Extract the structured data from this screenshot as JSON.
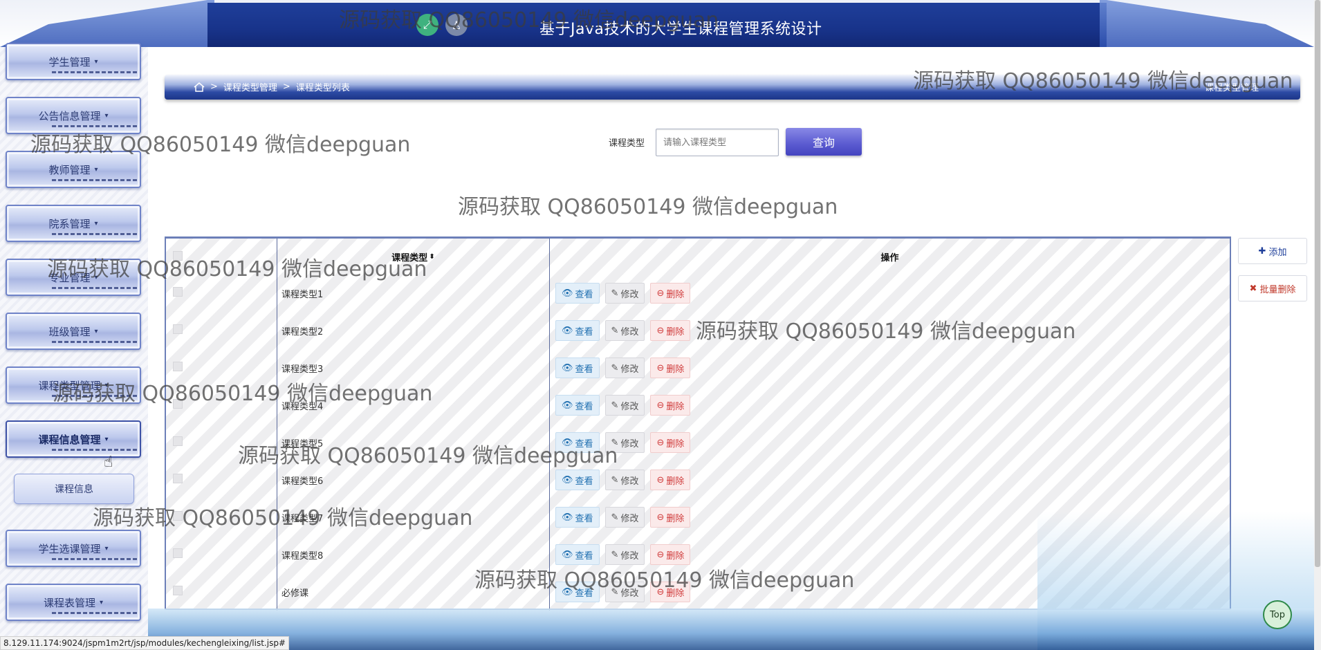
{
  "header": {
    "title": "基于Java技术的大学生课程管理系统设计",
    "icons": [
      "expand-icon",
      "user-icon"
    ]
  },
  "sidebar": {
    "items": [
      {
        "label": "学生管理"
      },
      {
        "label": "公告信息管理"
      },
      {
        "label": "教师管理"
      },
      {
        "label": "院系管理"
      },
      {
        "label": "专业管理"
      },
      {
        "label": "班级管理"
      },
      {
        "label": "课程类型管理"
      },
      {
        "label": "课程信息管理",
        "active": true
      },
      {
        "label": "学生选课管理"
      },
      {
        "label": "课程表管理"
      }
    ],
    "sub_items": [
      {
        "label": "课程信息"
      }
    ]
  },
  "breadcrumb": {
    "separator": ">",
    "items": [
      "课程类型管理",
      "课程类型列表"
    ],
    "right_text": "课程类型管理"
  },
  "search": {
    "label": "课程类型",
    "placeholder": "请输入课程类型",
    "button": "查询"
  },
  "table": {
    "columns": [
      "课程类型",
      "操作"
    ],
    "sort_glyph": "⬍",
    "actions": {
      "view": "查看",
      "edit": "修改",
      "delete": "删除"
    },
    "rows": [
      {
        "type": "课程类型1"
      },
      {
        "type": "课程类型2"
      },
      {
        "type": "课程类型3"
      },
      {
        "type": "课程类型4"
      },
      {
        "type": "课程类型5"
      },
      {
        "type": "课程类型6"
      },
      {
        "type": "课程类型7"
      },
      {
        "type": "课程类型8"
      },
      {
        "type": "必修课"
      }
    ]
  },
  "side_actions": {
    "add": "添加",
    "batch_delete": "批量删除"
  },
  "top_button": "Top",
  "status_url": "8.129.11.174:9024/jspm1m2rt/jsp/modules/kechengleixing/list.jsp#",
  "watermark": "源码获取 QQ86050149 微信deepguan",
  "colors": {
    "primary": "#1f3f9a",
    "accent": "#5a5ad0",
    "danger": "#d03b3b"
  }
}
